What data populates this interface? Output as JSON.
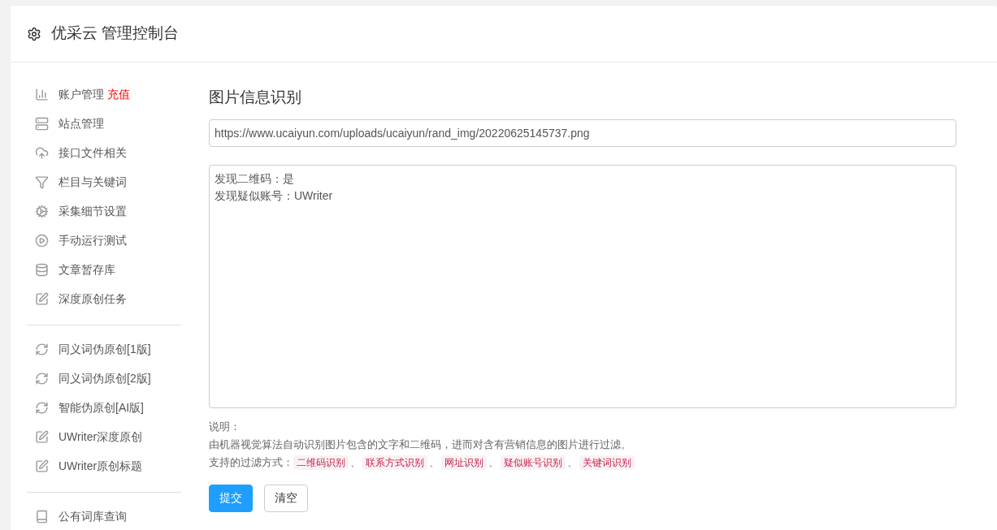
{
  "header": {
    "title": "优采云 管理控制台"
  },
  "sidebar": {
    "groups": [
      {
        "items": [
          {
            "label": "账户管理",
            "badge": "充值"
          },
          {
            "label": "站点管理"
          },
          {
            "label": "接口文件相关"
          },
          {
            "label": "栏目与关键词"
          },
          {
            "label": "采集细节设置"
          },
          {
            "label": "手动运行测试"
          },
          {
            "label": "文章暂存库"
          },
          {
            "label": "深度原创任务"
          }
        ]
      },
      {
        "items": [
          {
            "label": "同义词伪原创[1版]"
          },
          {
            "label": "同义词伪原创[2版]"
          },
          {
            "label": "智能伪原创[AI版]"
          },
          {
            "label": "UWriter深度原创"
          },
          {
            "label": "UWriter原创标题"
          }
        ]
      },
      {
        "items": [
          {
            "label": "公有词库查询"
          }
        ]
      }
    ]
  },
  "main": {
    "title": "图片信息识别",
    "url_field": {
      "value": "https://www.ucaiyun.com/uploads/ucaiyun/rand_img/20220625145737.png"
    },
    "result_lines": [
      "发现二维码：是",
      "发现疑似账号：UWriter"
    ],
    "notes": {
      "heading": "说明：",
      "description": "由机器视觉算法自动识别图片包含的文字和二维码，进而对含有营销信息的图片进行过滤。",
      "filters_label": "支持的过滤方式：",
      "filters": [
        {
          "label": "二维码识别",
          "after": "、"
        },
        {
          "label": "联系方式识别",
          "after": "、"
        },
        {
          "label": "网址识别",
          "after": "、"
        },
        {
          "label": "疑似账号识别",
          "after": "、"
        },
        {
          "label": "关键词识别"
        }
      ]
    },
    "buttons": [
      {
        "label": "提交",
        "kind": "primary"
      },
      {
        "label": "清空",
        "kind": "default"
      }
    ]
  }
}
